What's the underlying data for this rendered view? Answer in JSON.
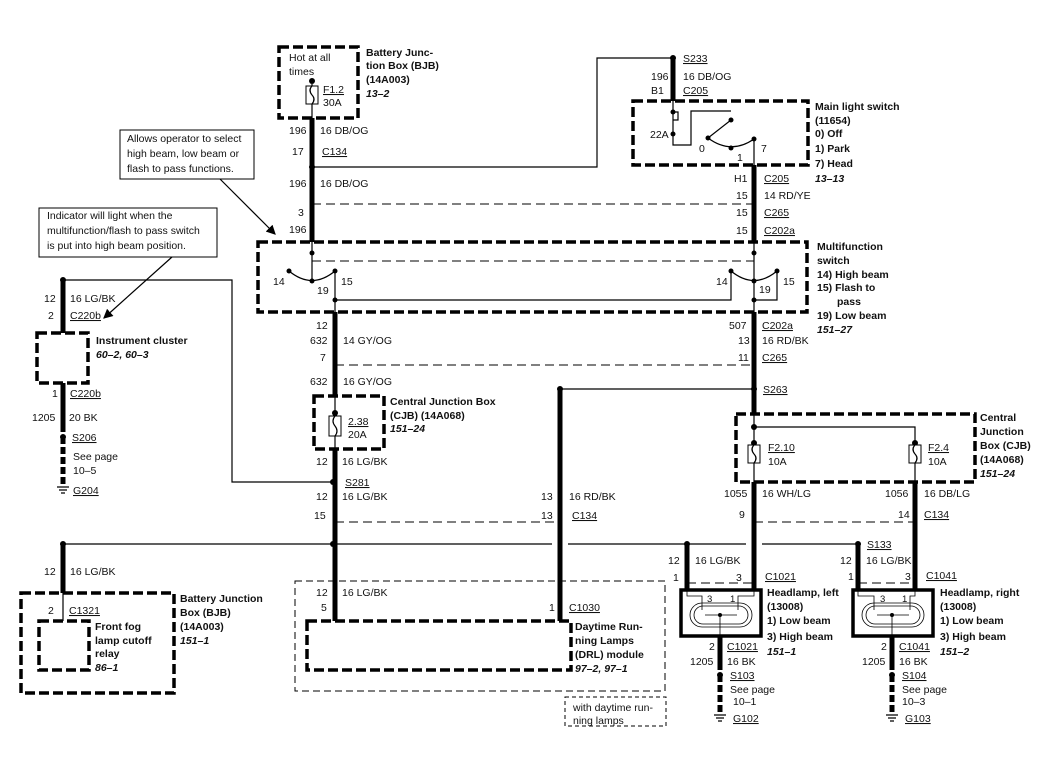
{
  "top_bjb": {
    "hot": [
      "Hot at all",
      "times"
    ],
    "fuse": "F1.2",
    "rating": "30A",
    "name": [
      "Battery Junc-",
      "tion Box (BJB)",
      "(14A003)"
    ],
    "page": "13–2"
  },
  "wire_top": {
    "circuit": "196",
    "gauge_color": "16 DB/OG",
    "pin": "17",
    "connector": "C134",
    "circuit2": "196",
    "gauge_color2": "16 DB/OG",
    "pin3": "3",
    "circuit3": "196"
  },
  "main_switch_feed": {
    "splice": "S233",
    "circuit": "196",
    "gauge_color": "16 DB/OG",
    "pin": "B1",
    "connector": "C205"
  },
  "main_light_switch": {
    "contact": "22A",
    "pos0": "0",
    "pos1": "1",
    "pos7": "7",
    "name": [
      "Main light switch",
      "(11654)"
    ],
    "items": [
      "0)   Off",
      "1)   Park",
      "7)   Head"
    ],
    "page": "13–13"
  },
  "main_switch_out": {
    "pin_h1": "H1",
    "connector_c205": "C205",
    "circuit": "15",
    "gauge_color": "14 RD/YE",
    "pin_c265": "15",
    "connector_c265": "C265",
    "pin_c202a": "15",
    "connector_c202a": "C202a"
  },
  "multifunction": {
    "name": [
      "Multifunction",
      "switch"
    ],
    "items": [
      "14) High beam",
      "15) Flash to",
      "pass",
      "19) Low beam"
    ],
    "page": "151–27",
    "left_contacts": [
      "14",
      "19",
      "15"
    ],
    "right_contacts": [
      "14",
      "19",
      "15"
    ]
  },
  "callouts": {
    "operator": [
      "Allows operator to select",
      "high beam, low beam or",
      "flash to pass functions."
    ],
    "indicator": [
      "Indicator will light when the",
      "multifunction/flash to pass switch",
      "is put into high beam position."
    ]
  },
  "left_column": {
    "pin12": "12",
    "circuit": "632",
    "gauge_color": "14 GY/OG",
    "pin7": "7",
    "circuit2": "632",
    "gauge_color2": "16 GY/OG"
  },
  "cjb_small": {
    "name": [
      "Central Junction Box",
      "(CJB) (14A068)"
    ],
    "page": "151–24",
    "fuse": "2.38",
    "rating": "20A"
  },
  "cjb_out": {
    "circuit": "12",
    "gauge_color": "16 LG/BK",
    "splice": "S281",
    "circuit2": "12",
    "gauge_color2": "16 LG/BK",
    "pin": "15"
  },
  "drl_feed": {
    "circuit": "13",
    "gauge_color": "16 RD/BK",
    "pin": "13",
    "connector": "C134"
  },
  "right_column": {
    "circuit": "507",
    "connector_c202a": "C202a",
    "pin13": "13",
    "gauge_color": "16 RD/BK",
    "pin11": "11",
    "connector_c265": "C265",
    "splice": "S263"
  },
  "cjb_right": {
    "name": [
      "Central",
      "Junction",
      "Box (CJB)",
      "(14A068)"
    ],
    "page": "151–24",
    "fuse_a": "F2.10",
    "rating_a": "10A",
    "fuse_b": "F2.4",
    "rating_b": "10A",
    "circuit_a": "1055",
    "gauge_a": "16 WH/LG",
    "pin_a": "9",
    "circuit_b": "1056",
    "gauge_b": "16 DB/LG",
    "pin_b": "14",
    "connector": "C134"
  },
  "instrument_cluster": {
    "circuit": "12",
    "gauge_color": "16 LG/BK",
    "pin2": "2",
    "connector_in": "C220b",
    "name": "Instrument cluster",
    "page": "60–2, 60–3",
    "pin1": "1",
    "connector_out": "C220b",
    "ground_circuit": "1205",
    "ground_gauge": "20 BK",
    "splice": "S206",
    "see_page": [
      "See page",
      "10–5"
    ],
    "ground": "G204"
  },
  "fog_relay": {
    "circuit": "12",
    "gauge_color": "16 LG/BK",
    "pin": "2",
    "connector": "C1321",
    "name": [
      "Front fog",
      "lamp cutoff",
      "relay"
    ],
    "page": "86–1",
    "bjb_name": [
      "Battery Junction",
      "Box (BJB)",
      "(14A003)"
    ],
    "bjb_page": "151–1"
  },
  "drl_module": {
    "circuit": "12",
    "gauge_color": "16 LG/BK",
    "pin5": "5",
    "pin1": "1",
    "connector": "C1030",
    "name": [
      "Daytime Run-",
      "ning Lamps",
      "(DRL) module"
    ],
    "page": "97–2, 97–1",
    "note": [
      "with daytime run-",
      "ning lamps"
    ]
  },
  "headlamp_left": {
    "circuit": "12",
    "gauge_color": "16 LG/BK",
    "pin1": "1",
    "pin3": "3",
    "connector": "C1021",
    "name": [
      "Headlamp, left",
      "(13008)"
    ],
    "items": [
      "1)   Low beam",
      "3)   High beam"
    ],
    "page": "151–1",
    "inner": [
      "3",
      "1"
    ],
    "ground_pin": "2",
    "ground_connector": "C1021",
    "ground_circuit": "1205",
    "ground_gauge": "16 BK",
    "splice": "S103",
    "see_page": [
      "See page",
      "10–1"
    ],
    "ground": "G102"
  },
  "headlamp_right": {
    "splice_top": "S133",
    "circuit": "12",
    "gauge_color": "16 LG/BK",
    "pin1": "1",
    "pin3": "3",
    "connector": "C1041",
    "name": [
      "Headlamp, right",
      "(13008)"
    ],
    "items": [
      "1)   Low beam",
      "3)   High beam"
    ],
    "page": "151–2",
    "inner": [
      "3",
      "1"
    ],
    "ground_pin": "2",
    "ground_connector": "C1041",
    "ground_circuit": "1205",
    "ground_gauge": "16 BK",
    "splice": "S104",
    "see_page": [
      "See page",
      "10–3"
    ],
    "ground": "G103"
  }
}
